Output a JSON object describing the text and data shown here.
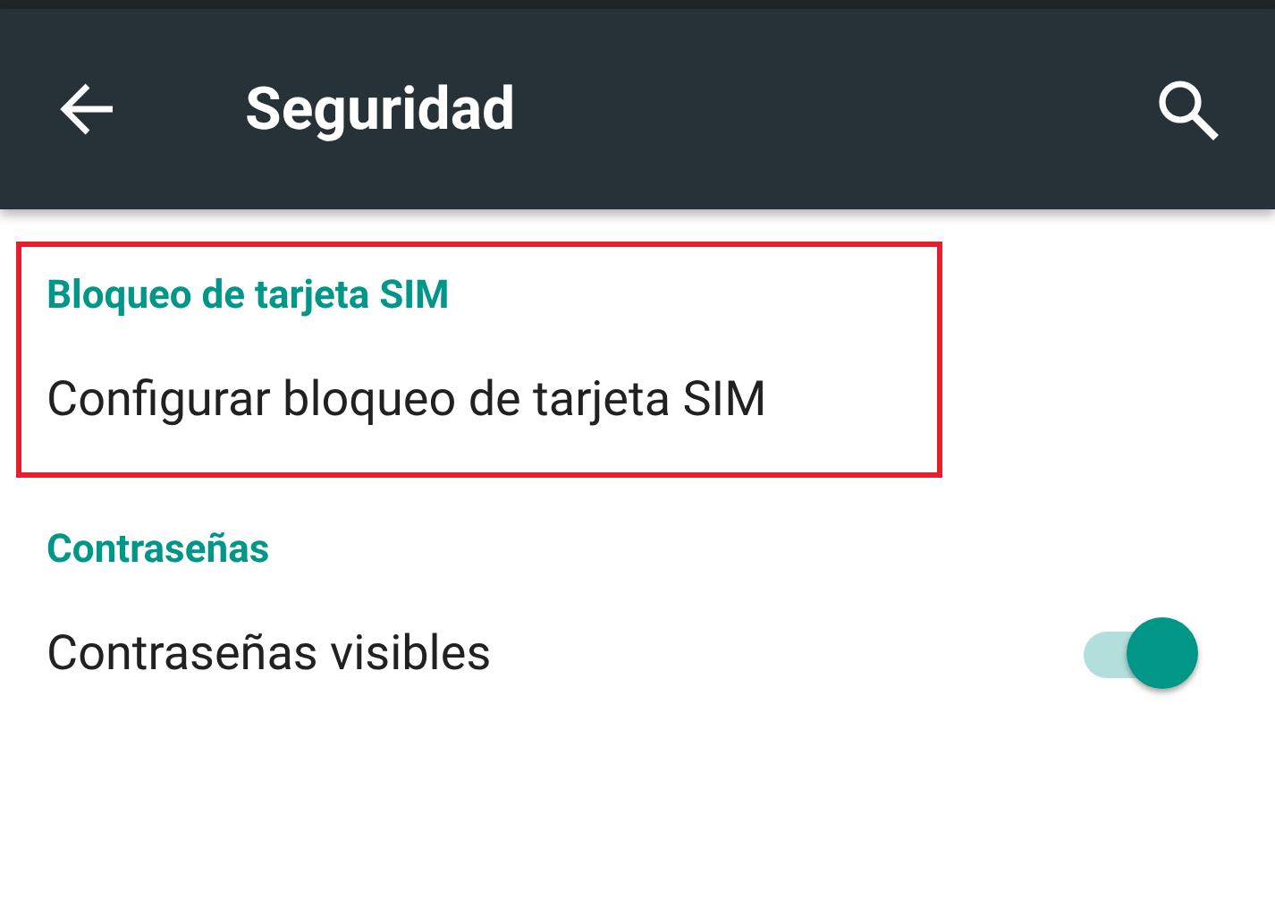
{
  "toolbar": {
    "title": "Seguridad"
  },
  "sections": [
    {
      "header": "Bloqueo de tarjeta SIM",
      "highlighted": true,
      "items": [
        {
          "kind": "plain",
          "label": "Configurar bloqueo de tarjeta SIM"
        }
      ]
    },
    {
      "header": "Contraseñas",
      "highlighted": false,
      "items": [
        {
          "kind": "switch",
          "label": "Contraseñas visibles",
          "on": true
        }
      ]
    }
  ]
}
